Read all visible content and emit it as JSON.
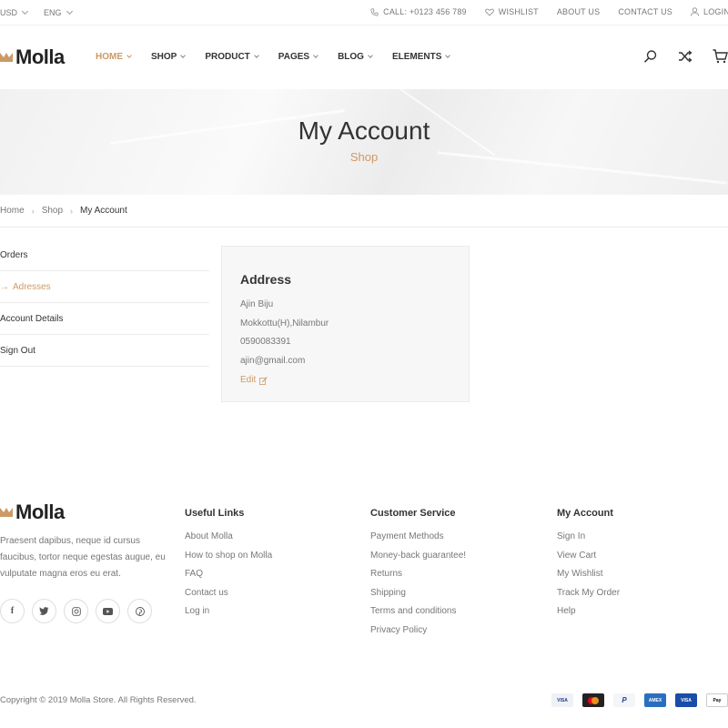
{
  "topbar": {
    "currency": "USD",
    "language": "ENG",
    "call": "CALL: +0123 456 789",
    "wishlist": "WISHLIST",
    "about": "ABOUT US",
    "contact": "CONTACT US",
    "login": "LOGIN"
  },
  "header": {
    "logo": "Molla",
    "nav": [
      "HOME",
      "SHOP",
      "PRODUCT",
      "PAGES",
      "BLOG",
      "ELEMENTS"
    ],
    "icons": [
      "search-icon",
      "shuffle-icon",
      "cart-icon"
    ]
  },
  "banner": {
    "title": "My Account",
    "subtitle": "Shop"
  },
  "breadcrumb": [
    "Home",
    "Shop",
    "My Account"
  ],
  "account_menu": [
    {
      "label": "Orders",
      "active": false
    },
    {
      "label": "Adresses",
      "active": true
    },
    {
      "label": "Account Details",
      "active": false
    },
    {
      "label": "Sign Out",
      "active": false
    }
  ],
  "address": {
    "heading": "Address",
    "name": "Ajin Biju",
    "street": "Mokkottu(H),Nilambur",
    "phone": "0590083391",
    "email": "ajin@gmail.com",
    "edit": "Edit"
  },
  "footer": {
    "logo": "Molla",
    "description": "Praesent dapibus, neque id cursus faucibus, tortor neque egestas augue, eu vulputate magna eros eu erat.",
    "social": [
      "f",
      "t",
      "ig",
      "yt",
      "p"
    ],
    "useful_links": {
      "title": "Useful Links",
      "items": [
        "About Molla",
        "How to shop on Molla",
        "FAQ",
        "Contact us",
        "Log in"
      ]
    },
    "customer_service": {
      "title": "Customer Service",
      "items": [
        "Payment Methods",
        "Money-back guarantee!",
        "Returns",
        "Shipping",
        "Terms and conditions",
        "Privacy Policy"
      ]
    },
    "my_account": {
      "title": "My Account",
      "items": [
        "Sign In",
        "View Cart",
        "My Wishlist",
        "Track My Order",
        "Help"
      ]
    },
    "copyright": "Copyright © 2019 Molla Store. All Rights Reserved.",
    "payments": [
      "VISA",
      "MC",
      "PayPal",
      "AMEX",
      "VISA",
      "Pay"
    ]
  },
  "colors": {
    "accent": "#cc9966",
    "text": "#333333",
    "muted": "#777777"
  }
}
